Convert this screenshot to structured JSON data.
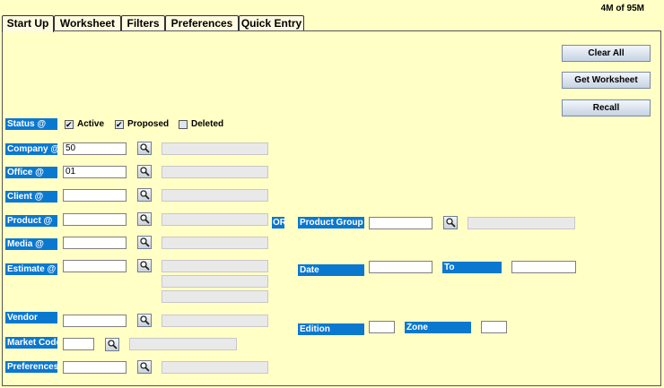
{
  "memory": "4M of 95M",
  "tabs": [
    "Start Up",
    "Worksheet",
    "Filters",
    "Preferences",
    "Quick Entry"
  ],
  "buttons": {
    "clear_all": "Clear All",
    "get_worksheet": "Get Worksheet",
    "recall": "Recall"
  },
  "status": {
    "label": "Status @",
    "active": "Active",
    "proposed": "Proposed",
    "deleted": "Deleted",
    "active_checked": true,
    "proposed_checked": true,
    "deleted_checked": false
  },
  "fields": {
    "company": {
      "label": "Company @",
      "value": "50"
    },
    "office": {
      "label": "Office @",
      "value": "01"
    },
    "client": {
      "label": "Client @",
      "value": ""
    },
    "product": {
      "label": "Product @",
      "value": ""
    },
    "media": {
      "label": "Media @",
      "value": ""
    },
    "estimate": {
      "label": "Estimate @",
      "value": ""
    },
    "vendor": {
      "label": "Vendor",
      "value": ""
    },
    "market_code": {
      "label": "Market Code",
      "value": ""
    },
    "preferences": {
      "label": "Preferences",
      "value": ""
    }
  },
  "or_label": "OR",
  "right": {
    "product_group": "Product Group @",
    "date": "Date",
    "to": "To",
    "edition": "Edition",
    "zone": "Zone"
  },
  "icons": {
    "lookup": "magnifier-icon"
  }
}
